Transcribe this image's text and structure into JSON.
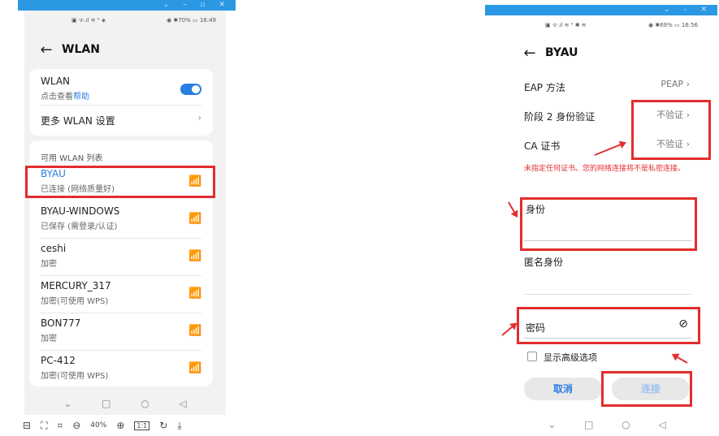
{
  "left": {
    "status_left": "▣ ᯤ.ıl ≋ ⁰ ◈",
    "status_right": "◉ ✱70% ▭ 16:49",
    "title": "WLAN",
    "wlan_label": "WLAN",
    "wlan_sub_prefix": "点击查看",
    "wlan_sub_link": "帮助",
    "more_settings": "更多 WLAN 设置",
    "list_header": "可用 WLAN 列表",
    "networks": [
      {
        "name": "BYAU",
        "status": "已连接 (网络质量好)"
      },
      {
        "name": "BYAU-WINDOWS",
        "status": "已保存 (需登录/认证)"
      },
      {
        "name": "ceshi",
        "status": "加密"
      },
      {
        "name": "MERCURY_317",
        "status": "加密(可使用 WPS)"
      },
      {
        "name": "BON777",
        "status": "加密"
      },
      {
        "name": "PC-412",
        "status": "加密(可使用 WPS)"
      }
    ],
    "zoom_level": "40%"
  },
  "right": {
    "status_left": "▣ ᯤ.ıl ≋ ⁰ ✱ ≋",
    "status_right": "◉ ✱69% ▭ 16:56",
    "title": "BYAU",
    "eap_label": "EAP 方法",
    "eap_value": "PEAP",
    "phase2_label": "阶段 2 身份验证",
    "phase2_value": "不验证",
    "ca_label": "CA 证书",
    "ca_value": "不验证",
    "warning": "未指定任何证书。您的网络连接将不是私密连接。",
    "identity_label": "身份",
    "anon_label": "匿名身份",
    "password_label": "密码",
    "advanced_label": "显示高级选项",
    "cancel": "取消",
    "connect": "连接"
  },
  "colors": {
    "accent": "#2a7de1",
    "highlight": "#e32d2d",
    "winbar": "#2b98e4"
  }
}
